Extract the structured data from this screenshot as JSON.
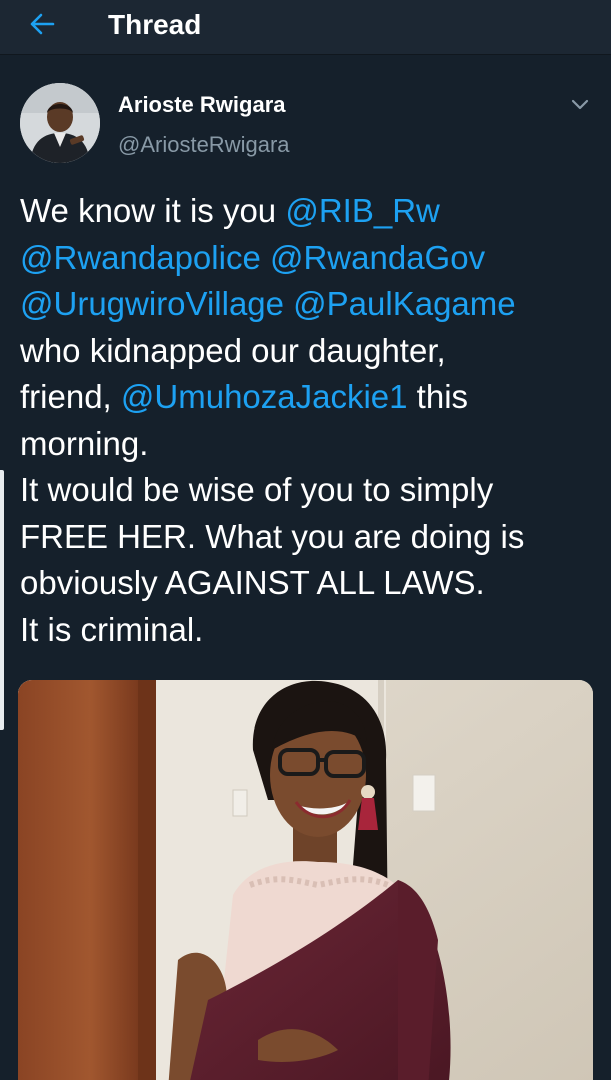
{
  "header": {
    "back_icon": "arrow-left-icon",
    "title": "Thread"
  },
  "tweet": {
    "author": {
      "display_name": "Arioste Rwigara",
      "handle": "@AriosteRwigara"
    },
    "menu_icon": "chevron-down-icon",
    "text_lines": [
      [
        {
          "t": "We know it is you ",
          "m": false
        },
        {
          "t": "@RIB_Rw",
          "m": true
        }
      ],
      [
        {
          "t": "@Rwandapolice",
          "m": true
        },
        {
          "t": " ",
          "m": false
        },
        {
          "t": "@RwandaGov",
          "m": true
        }
      ],
      [
        {
          "t": "@UrugwiroVillage",
          "m": true
        },
        {
          "t": " ",
          "m": false
        },
        {
          "t": "@PaulKagame",
          "m": true
        }
      ],
      [
        {
          "t": "who kidnapped our daughter,",
          "m": false
        }
      ],
      [
        {
          "t": "friend, ",
          "m": false
        },
        {
          "t": "@UmuhozaJackie1",
          "m": true
        },
        {
          "t": " this",
          "m": false
        }
      ],
      [
        {
          "t": "morning.",
          "m": false
        }
      ],
      [
        {
          "t": "It would be wise of you to simply",
          "m": false
        }
      ],
      [
        {
          "t": "FREE HER. What you are doing is",
          "m": false
        }
      ],
      [
        {
          "t": "obviously AGAINST ALL LAWS.",
          "m": false
        }
      ],
      [
        {
          "t": "It is criminal.",
          "m": false
        }
      ]
    ]
  },
  "colors": {
    "background": "#15202b",
    "header_background": "#1c2733",
    "accent": "#1da1f2",
    "secondary_text": "#8899a6",
    "primary_text": "#ffffff"
  }
}
